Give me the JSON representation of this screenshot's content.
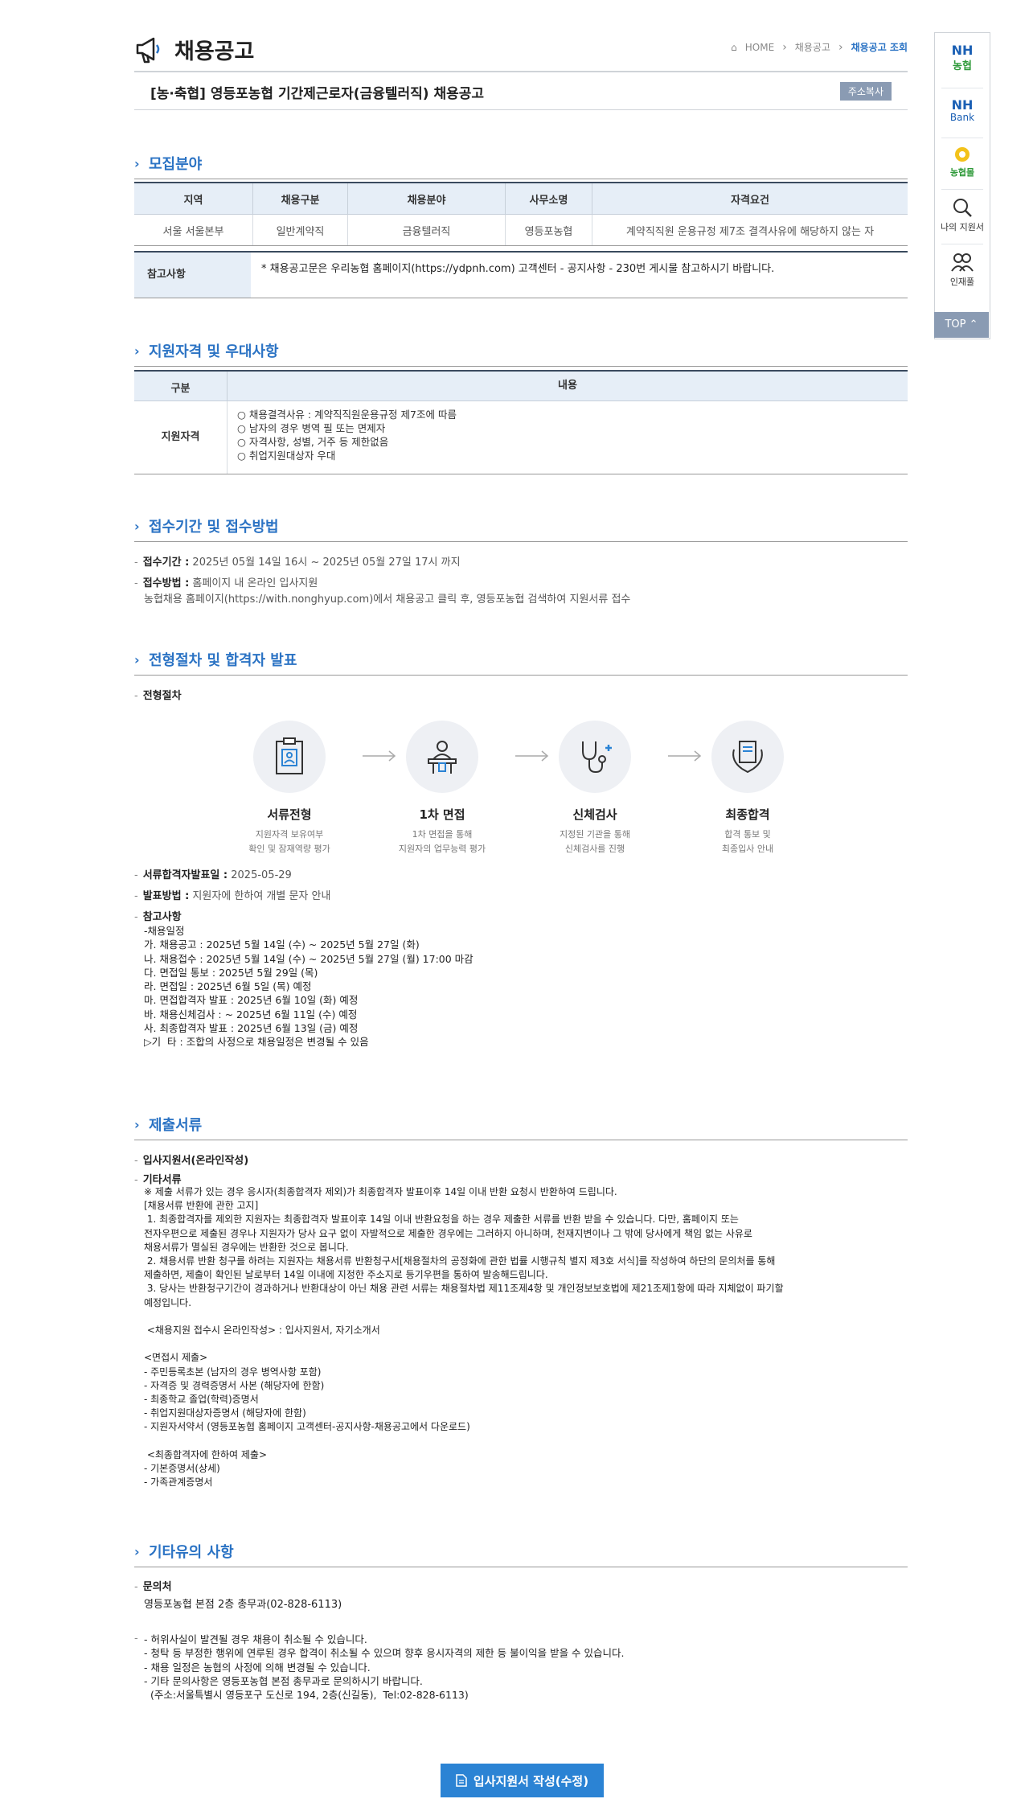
{
  "header": {
    "title": "채용공고",
    "breadcrumb": [
      "HOME",
      "채용공고",
      "채용공고 조회"
    ]
  },
  "job": {
    "title": "[농·축협] 영등포농협 기간제근로자(금융텔러직) 채용공고",
    "copy_label": "주소복사"
  },
  "recruit": {
    "section_title": "모집분야",
    "columns": [
      "지역",
      "채용구분",
      "채용분야",
      "사무소명",
      "자격요건"
    ],
    "row": [
      "서울 서울본부",
      "일반계약직",
      "금융텔러직",
      "영등포농협",
      "계약직직원 운용규정 제7조 결격사유에 해당하지 않는 자"
    ],
    "note_label": "참고사항",
    "note_text": "* 채용공고문은 우리농협 홈페이지(https://ydpnh.com) 고객센터 - 공지사항 - 230번 게시물 참고하시기 바랍니다."
  },
  "qualification": {
    "section_title": "지원자격 및 우대사항",
    "col1": "구분",
    "col2": "내용",
    "row_label": "지원자격",
    "lines": [
      "○ 채용결격사유 : 계약직직원운용규정 제7조에 따름",
      "○ 남자의 경우 병역 필 또는 면제자",
      "○ 자격사항, 성별, 거주 등 제한없음",
      "○ 취업지원대상자 우대"
    ]
  },
  "reception": {
    "section_title": "접수기간 및 접수방법",
    "period_label": "접수기간 :",
    "period_value": "2025년 05월 14일 16시 ~ 2025년 05월 27일 17시 까지",
    "method_label": "접수방법 :",
    "method_value": "홈페이지 내 온라인 입사지원",
    "method_detail": "농협채용 홈페이지(https://with.nonghyup.com)에서 채용공고 클릭 후, 영등포농협 검색하여 지원서류 접수"
  },
  "process": {
    "section_title": "전형절차 및 합격자 발표",
    "procedure_label": "전형절차",
    "steps": [
      {
        "name": "서류전형",
        "desc1": "지원자격 보유여부",
        "desc2": "확인 및 잠재역량 평가",
        "icon": "clipboard-icon"
      },
      {
        "name": "1차 면접",
        "desc1": "1차 면접을 통해",
        "desc2": "지원자의 업무능력 평가",
        "icon": "interview-icon"
      },
      {
        "name": "신체검사",
        "desc1": "지정된 기관을 통해",
        "desc2": "신체검사를 진행",
        "icon": "stethoscope-icon"
      },
      {
        "name": "최종합격",
        "desc1": "합격 통보 및",
        "desc2": "최종입사 안내",
        "icon": "certificate-icon"
      }
    ],
    "announce_label": "서류합격자발표일 :",
    "announce_value": "2025-05-29",
    "method_label": "발표방법 :",
    "method_value": "지원자에 한하여 개별 문자 안내",
    "note_label": "참고사항",
    "note_block": "-채용일정\n가. 채용공고 : 2025년 5월 14일 (수) ~ 2025년 5월 27일 (화)\n나. 채용접수 : 2025년 5월 14일 (수) ~ 2025년 5월 27일 (월) 17:00 마감\n다. 면접일 통보 : 2025년 5월 29일 (목)\n라. 면접일 : 2025년 6월 5일 (목) 예정\n마. 면접합격자 발표 : 2025년 6월 10일 (화) 예정\n바. 채용신체검사 : ~ 2025년 6월 11일 (수) 예정\n사. 최종합격자 발표 : 2025년 6월 13일 (금) 예정\n▷기  타 : 조합의 사정으로 채용일정은 변경될 수 있음"
  },
  "documents": {
    "section_title": "제출서류",
    "item1": "입사지원서(온라인작성)",
    "item2": "기타서류",
    "block": "※ 제출 서류가 있는 경우 응시자(최종합격자 제외)가 최종합격자 발표이후 14일 이내 반환 요청시 반환하여 드립니다.\n[채용서류 반환에 관한 고지]\n 1. 최종합격자를 제외한 지원자는 최종합격자 발표이후 14일 이내 반환요청을 하는 경우 제출한 서류를 반환 받을 수 있습니다. 다만, 홈페이지 또는\n전자우편으로 제출된 경우나 지원자가 당사 요구 없이 자발적으로 제출한 경우에는 그러하지 아니하며, 천재지변이나 그 밖에 당사에게 책임 없는 사유로\n채용서류가 멸실된 경우에는 반환한 것으로 봅니다.\n 2. 채용서류 반환 청구를 하려는 지원자는 채용서류 반환청구서[채용절차의 공정화에 관한 법률 시행규칙 별지 제3호 서식]를 작성하여 하단의 문의처를 통해\n제출하면, 제출이 확인된 날로부터 14일 이내에 지정한 주소지로 등기우편을 통하여 발송해드립니다.\n 3. 당사는 반환청구기간이 경과하거나 반환대상이 아닌 채용 관련 서류는 채용절차법 제11조제4항 및 개인정보보호법에 제21조제1항에 따라 지체없이 파기할\n예정입니다.\n\n <채용지원 접수시 온라인작성> : 입사지원서, 자기소개서\n\n<면접시 제출>\n- 주민등록초본 (남자의 경우 병역사항 포함)\n- 자격증 및 경력증명서 사본 (해당자에 한함)\n- 최종학교 졸업(학력)증명서\n- 취업지원대상자증명서 (해당자에 한함)\n- 지원자서약서 (영등포농협 홈페이지 고객센터-공지사항-채용공고에서 다운로드)\n\n <최종합격자에 한하여 제출>\n- 기본증명서(상세)\n- 가족관계증명서"
  },
  "other": {
    "section_title": "기타유의 사항",
    "contact_label": "문의처",
    "contact_value": "영등포농협 본점 2층 총무과(02-828-6113)",
    "block": "- 허위사실이 발견될 경우 채용이 취소될 수 있습니다.\n- 청탁 등 부정한 행위에 연루된 경우 합격이 취소될 수 있으며 향후 응시자격의 제한 등 불이익을 받을 수 있습니다.\n- 채용 일정은 농협의 사정에 의해 변경될 수 있습니다.\n- 기타 문의사항은 영등포농협 본점 총무과로 문의하시기 바랍니다.\n  (주소:서울특별시 영등포구 도신로 194, 2층(신길동),  Tel:02-828-6113)"
  },
  "apply_button": "입사지원서 작성(수정)",
  "quickbar": {
    "nh1": "NH",
    "nh1b": "농협",
    "nh2": "NH",
    "nh2b": "Bank",
    "mall": "농협몰",
    "my": "나의 지원서",
    "talent": "인재풀",
    "top": "TOP"
  },
  "colors": {
    "accent": "#2b73c4",
    "button": "#2b83d4",
    "table_head": "#e6eef7"
  }
}
